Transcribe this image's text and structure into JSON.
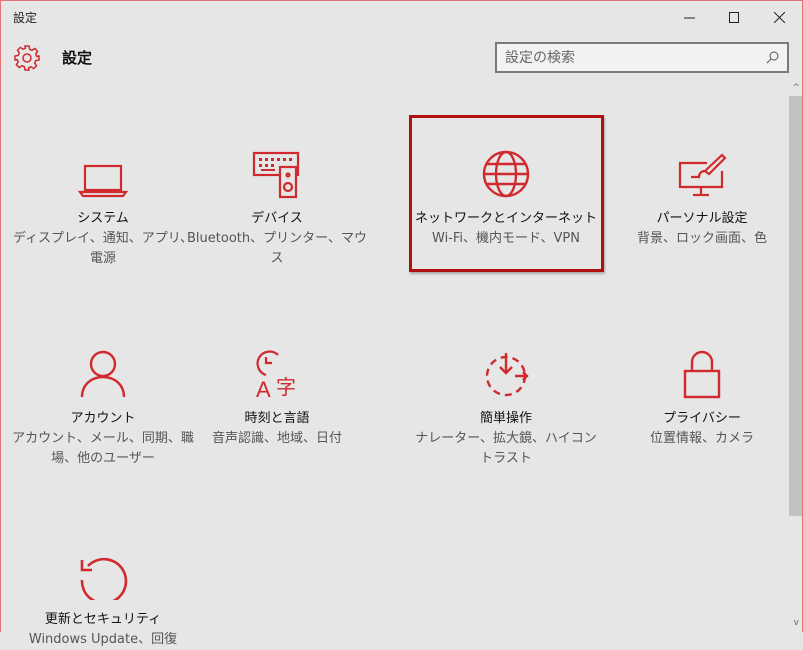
{
  "window": {
    "title": "設定",
    "minimize_icon": "minimize-icon",
    "maximize_icon": "maximize-icon",
    "close_icon": "close-icon"
  },
  "header": {
    "title": "設定",
    "icon": "gear-icon"
  },
  "search": {
    "placeholder": "設定の検索",
    "icon": "search-icon"
  },
  "accent": "#d02a2f",
  "tiles": [
    {
      "title": "システム",
      "subtitle": "ディスプレイ、通知、アプリ、電源",
      "icon": "laptop-icon"
    },
    {
      "title": "デバイス",
      "subtitle": "Bluetooth、プリンター、マウス",
      "icon": "keyboard-speaker-icon"
    },
    {
      "title": "ネットワークとインターネット",
      "subtitle": "Wi-Fi、機内モード、VPN",
      "icon": "globe-icon",
      "selected": true
    },
    {
      "title": "パーソナル設定",
      "subtitle": "背景、ロック画面、色",
      "icon": "monitor-brush-icon"
    },
    {
      "title": "アカウント",
      "subtitle": "アカウント、メール、同期、職場、他のユーザー",
      "icon": "person-icon"
    },
    {
      "title": "時刻と言語",
      "subtitle": "音声認識、地域、日付",
      "icon": "clock-language-icon"
    },
    {
      "title": "簡単操作",
      "subtitle": "ナレーター、拡大鏡、ハイコントラスト",
      "icon": "ease-of-access-icon"
    },
    {
      "title": "プライバシー",
      "subtitle": "位置情報、カメラ",
      "icon": "lock-icon"
    },
    {
      "title": "更新とセキュリティ",
      "subtitle": "Windows Update、回復",
      "icon": "refresh-icon"
    }
  ]
}
